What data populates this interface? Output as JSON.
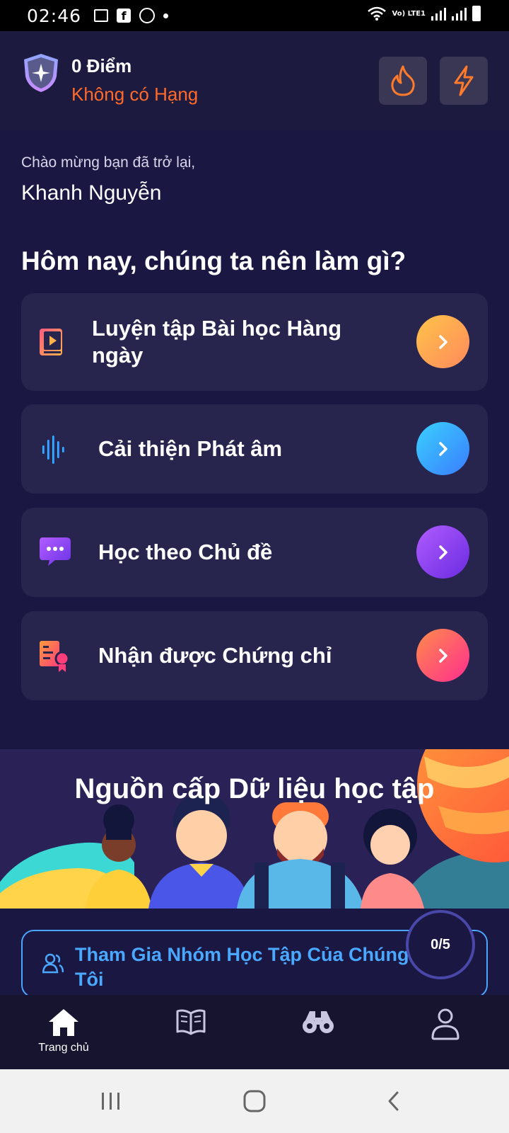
{
  "status_bar": {
    "time": "02:46",
    "network_label": "Vo) LTE1"
  },
  "header": {
    "points": "0 Điểm",
    "rank": "Không có Hạng",
    "streak_icon": "fire-icon",
    "energy_icon": "bolt-icon"
  },
  "greeting": {
    "welcome": "Chào mừng bạn đã trở lại,",
    "name": "Khanh Nguyễn"
  },
  "section_title": "Hôm nay, chúng ta nên làm gì?",
  "actions": [
    {
      "label": "Luyện tập Bài học Hàng ngày",
      "icon": "lesson-video-icon",
      "color": "#ffa547"
    },
    {
      "label": "Cải thiện Phát âm",
      "icon": "soundwave-icon",
      "color": "#3aa0ff"
    },
    {
      "label": "Học theo Chủ đề",
      "icon": "chat-bubble-icon",
      "color": "#8b3cf5"
    },
    {
      "label": "Nhận được Chứng chỉ",
      "icon": "certificate-icon",
      "color": "#ff4d8d"
    }
  ],
  "feed": {
    "title": "Nguồn cấp Dữ liệu học tập"
  },
  "join_group": {
    "label": "Tham Gia Nhóm Học Tập Của Chúng Tôi",
    "progress": "0/5"
  },
  "bottom_nav": {
    "home_label": "Trang chủ"
  },
  "colors": {
    "background": "#1a1743",
    "card": "#27244d",
    "rank_orange": "#ff6a2a",
    "link_blue": "#4aa8ff"
  }
}
